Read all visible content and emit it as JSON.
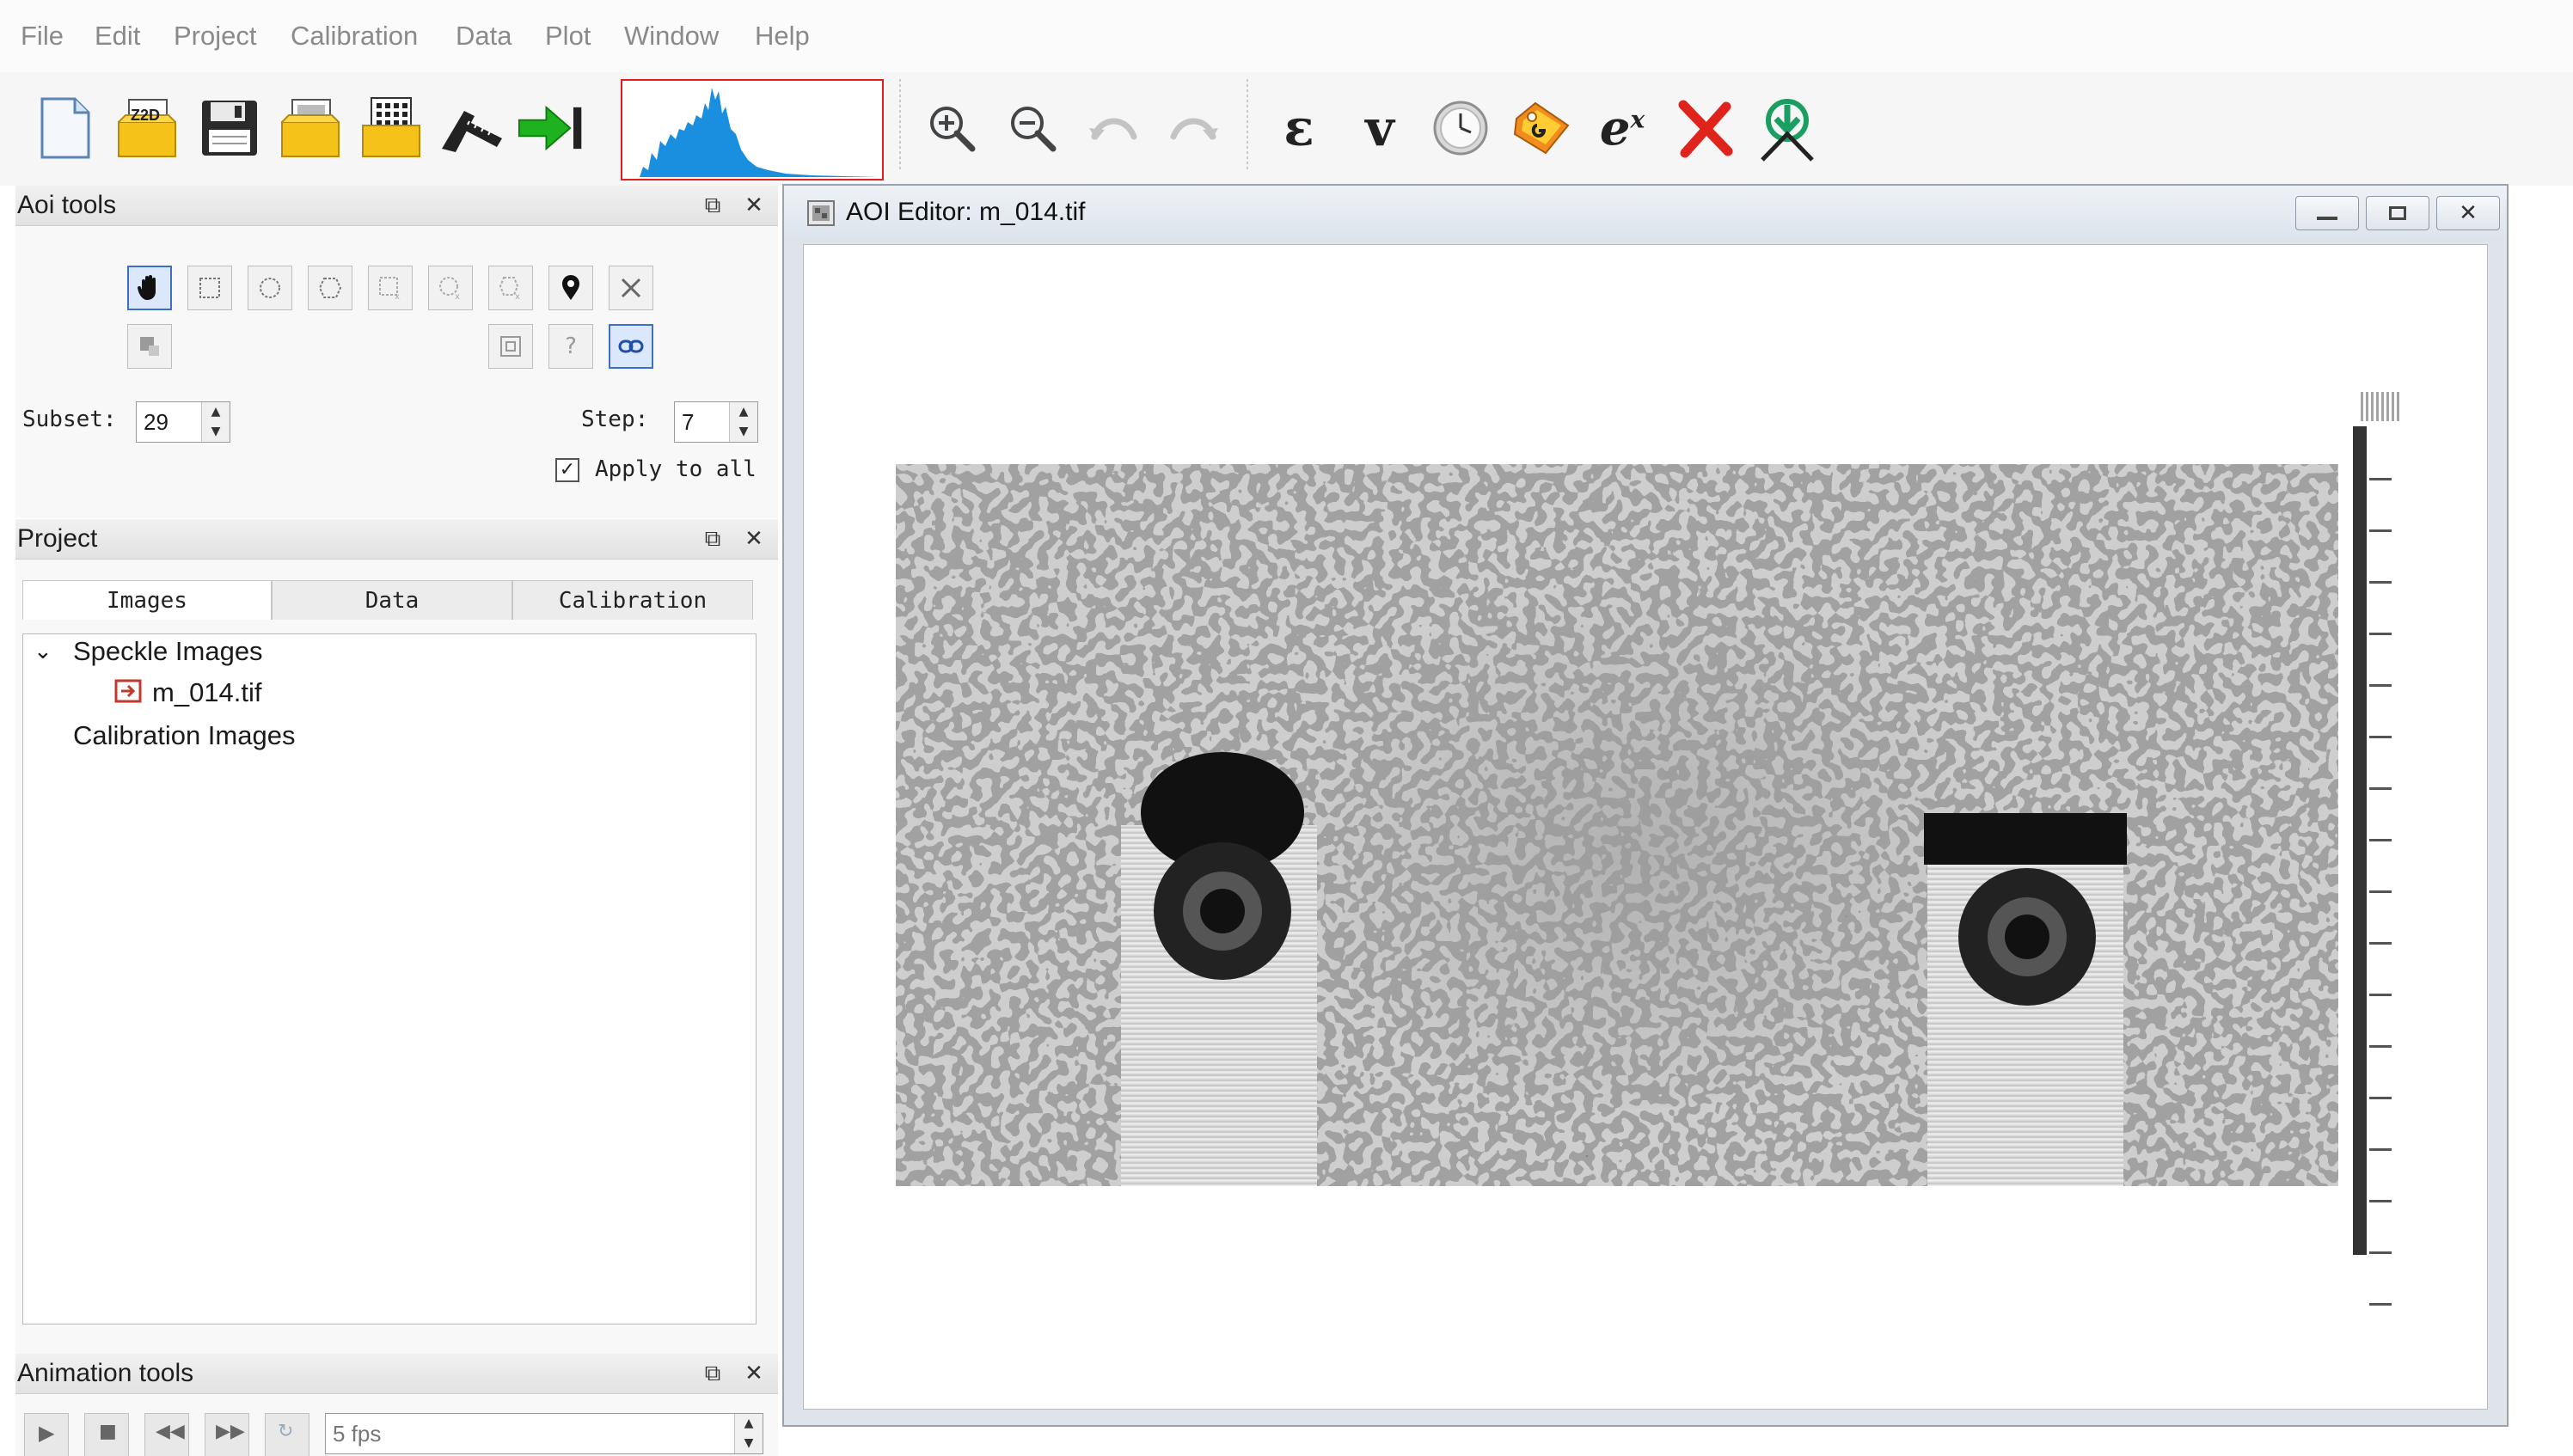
{
  "menu": {
    "items": [
      "File",
      "Edit",
      "Project",
      "Calibration",
      "Data",
      "Plot",
      "Window",
      "Help"
    ]
  },
  "toolbar": {
    "z2d_label": "Z2D",
    "strain_symbol": "ε",
    "velocity_symbol": "v",
    "expression_symbol": "e",
    "expression_superscript": "x",
    "icons": [
      "new-file-icon",
      "open-z2d-icon",
      "save-icon",
      "open-images-icon",
      "open-grid-icon",
      "calibration-tool-icon",
      "run-arrow-icon",
      "histogram-icon",
      "zoom-in-icon",
      "zoom-out-icon",
      "undo-icon",
      "redo-icon",
      "strain-icon",
      "velocity-icon",
      "clock-icon",
      "tag-icon",
      "expression-icon",
      "delete-icon",
      "download-icon"
    ],
    "accent_colors": {
      "histogram": "#1a8fe0",
      "run_arrow": "#1fb21f",
      "delete": "#e0241c",
      "folder": "#f5c21a",
      "download": "#1b9e62"
    }
  },
  "aoi_tools": {
    "title": "Aoi tools",
    "subset_label": "Subset:",
    "subset_value": "29",
    "step_label": "Step:",
    "step_value": "7",
    "apply_all_label": "Apply to all",
    "apply_all_checked": true
  },
  "project": {
    "title": "Project",
    "tabs": [
      "Images",
      "Data",
      "Calibration"
    ],
    "active_tab": "Images",
    "tree": {
      "group1": "Speckle Images",
      "file1": "m_014.tif",
      "group2": "Calibration Images"
    }
  },
  "animation": {
    "title": "Animation tools",
    "fps": "5 fps"
  },
  "aoi_editor": {
    "title": "AOI Editor: m_014.tif"
  }
}
